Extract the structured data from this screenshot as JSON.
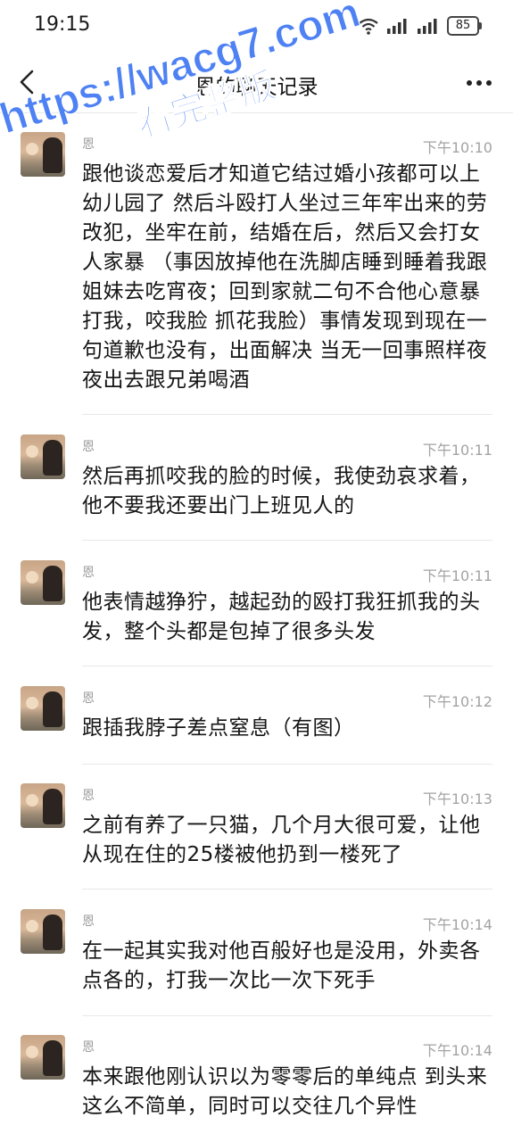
{
  "status_bar": {
    "time": "19:15",
    "battery": "85"
  },
  "nav": {
    "title": "恩的聊天记录"
  },
  "watermark": {
    "line1": "https://wacg7.com",
    "line2": "看完整版"
  },
  "messages": [
    {
      "sender": "恩",
      "time": "下午10:10",
      "text": "跟他谈恋爱后才知道它结过婚小孩都可以上幼儿园了 然后斗殴打人坐过三年牢出来的劳改犯，坐牢在前，结婚在后，然后又会打女人家暴 （事因放掉他在洗脚店睡到睡着我跟姐妹去吃宵夜；回到家就二句不合他心意暴打我，咬我脸 抓花我脸）事情发现到现在一句道歉也没有，出面解决 当无一回事照样夜夜出去跟兄弟喝酒"
    },
    {
      "sender": "恩",
      "time": "下午10:11",
      "text": "然后再抓咬我的脸的时候，我使劲哀求着，他不要我还要出门上班见人的"
    },
    {
      "sender": "恩",
      "time": "下午10:11",
      "text": "他表情越狰狞，越起劲的殴打我狂抓我的头发，整个头都是包掉了很多头发"
    },
    {
      "sender": "恩",
      "time": "下午10:12",
      "text": "跟插我脖子差点窒息（有图）"
    },
    {
      "sender": "恩",
      "time": "下午10:13",
      "text": "之前有养了一只猫，几个月大很可爱，让他从现在住的25楼被他扔到一楼死了"
    },
    {
      "sender": "恩",
      "time": "下午10:14",
      "text": "在一起其实我对他百般好也是没用，外卖各点各的，打我一次比一次下死手"
    },
    {
      "sender": "恩",
      "time": "下午10:14",
      "text": "本来跟他刚认识以为零零后的单纯点 到头来这么不简单，同时可以交往几个异性"
    }
  ]
}
